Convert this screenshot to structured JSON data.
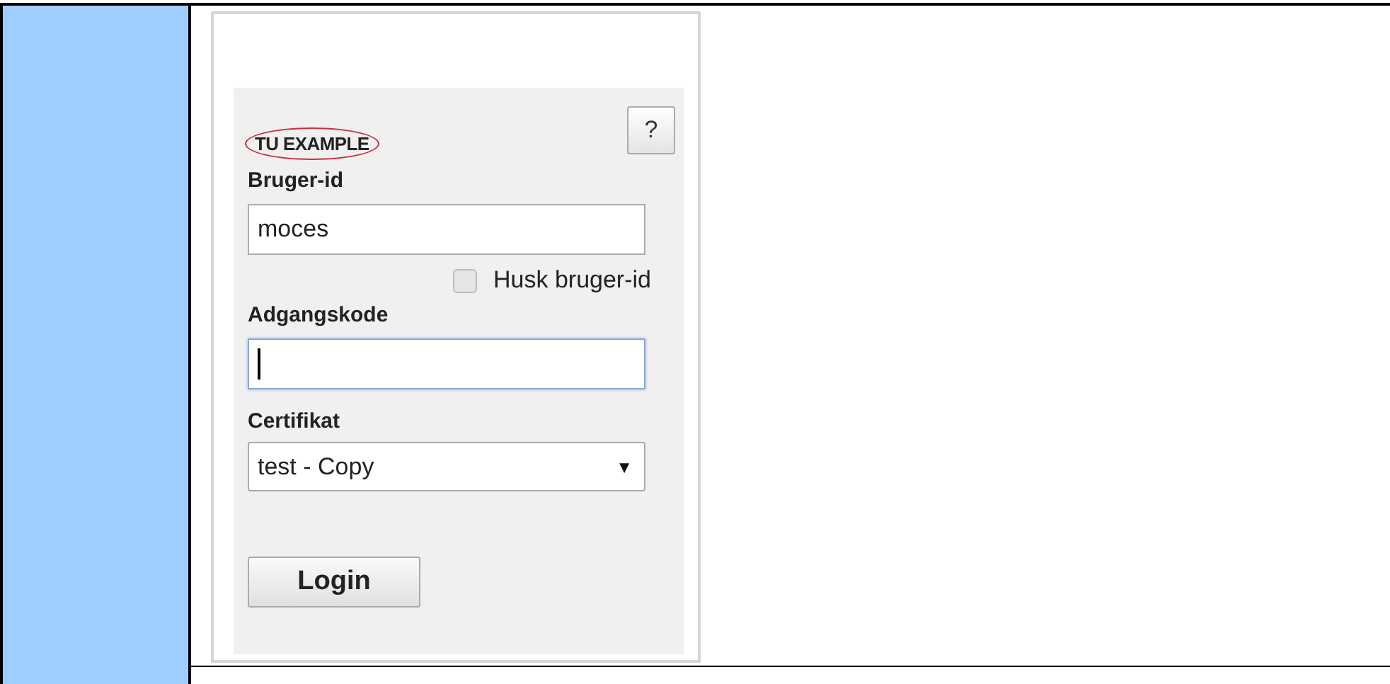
{
  "login": {
    "title": "TU EXAMPLE",
    "title_circled": true,
    "help_button": "?",
    "user_label": "Bruger-id",
    "user_value": "moces",
    "remember": {
      "label": "Husk bruger-id",
      "checked": false
    },
    "password_label": "Adgangskode",
    "password_focused": true,
    "certificate_label": "Certifikat",
    "certificate_value": "test - Copy",
    "select_arrow": "▼",
    "login_button": "Login"
  }
}
